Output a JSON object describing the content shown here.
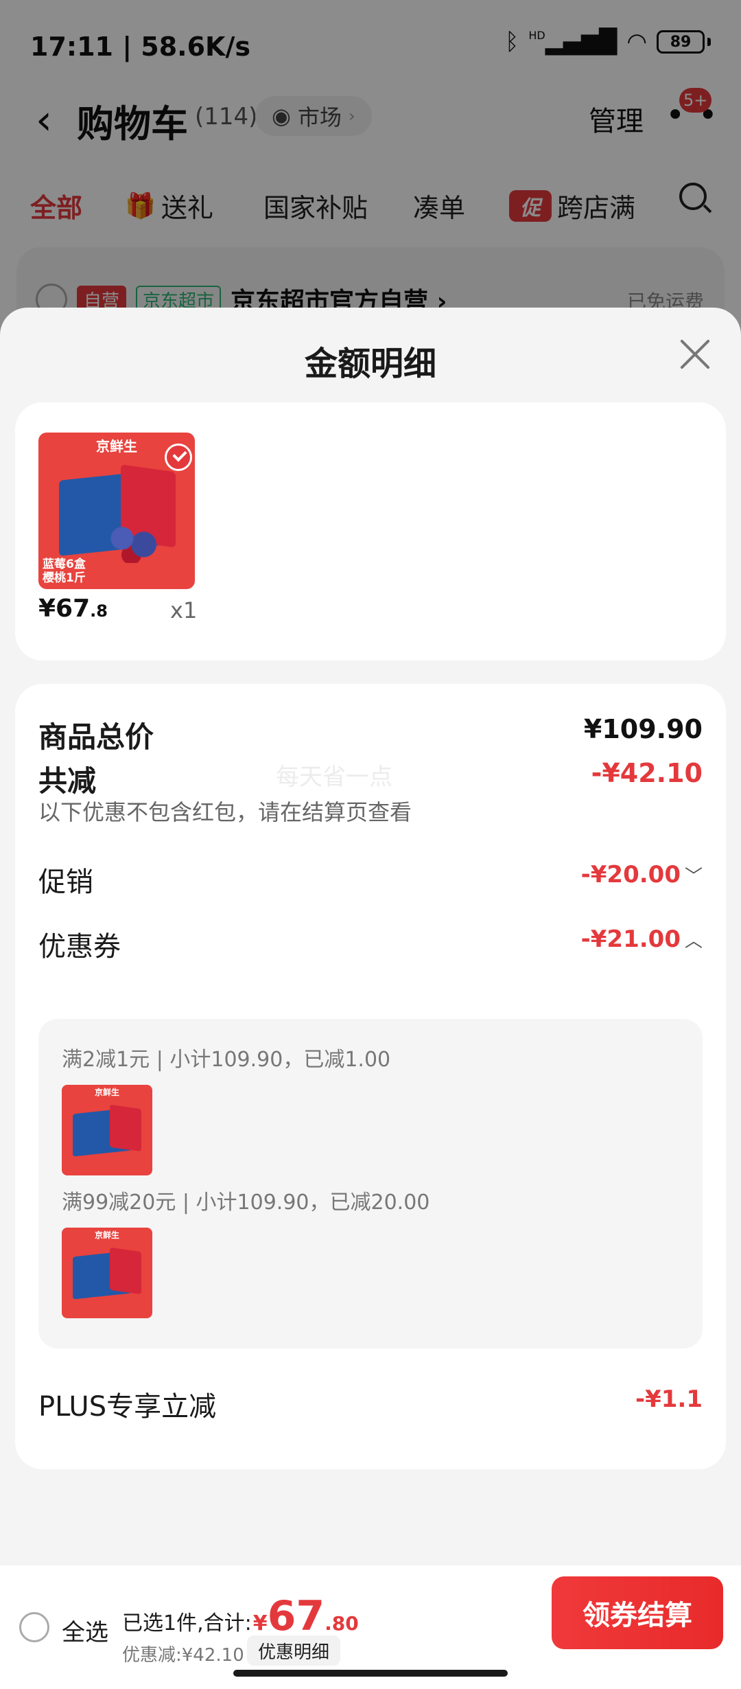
{
  "status_bar": {
    "time": "17:11 | 58.6K/s",
    "battery": "89",
    "signal_label": "HD"
  },
  "navbar": {
    "title": "购物车",
    "count": "(114)",
    "market_label": "市场",
    "manage_label": "管理",
    "more_badge": "5+"
  },
  "tabs": [
    {
      "label": "全部"
    },
    {
      "label": "送礼"
    },
    {
      "label": "国家补贴"
    },
    {
      "label": "凑单"
    },
    {
      "label": "跨店满"
    }
  ],
  "promo_tab_icon": "促",
  "store": {
    "self_tag": "自营",
    "super_tag": "京东超市",
    "name": "京东超市官方自营 ›",
    "freight": "已免运费"
  },
  "sheet": {
    "title": "金额明细",
    "item": {
      "brand": "京鲜生",
      "sub_brand": "蓝莓+樱桃",
      "thumb_text": "蓝莓6盒\n樱桃1斤",
      "price_main": "¥67",
      "price_dec": ".8",
      "qty": "x1"
    },
    "total_label": "商品总价",
    "total_value": "¥109.90",
    "reduce_label": "共减",
    "reduce_value": "-¥42.10",
    "watermark": "每天省一点",
    "reduce_note": "以下优惠不包含红包，请在结算页查看",
    "promo_label": "促销",
    "promo_value": "-¥20.00",
    "coupon_label": "优惠券",
    "coupon_value": "-¥21.00",
    "coupons": [
      {
        "line": "满2减1元 | 小计109.90，已减1.00"
      },
      {
        "line": "满99减20元 | 小计109.90，已减20.00"
      }
    ],
    "plus_label": "PLUS专享立减",
    "plus_value": "-¥1.1"
  },
  "bottom_bar": {
    "select_all": "全选",
    "summary_prefix": "已选1件,合计:",
    "currency": "¥",
    "amount_int": "67",
    "amount_dec": ".80",
    "discount_text": "优惠减:¥42.10",
    "discount_detail": "优惠明细",
    "checkout": "领券结算"
  },
  "colors": {
    "accent": "#e4393c",
    "sheet_bg": "#f4f4f4",
    "overlay": "rgba(0,0,0,0.45)"
  }
}
